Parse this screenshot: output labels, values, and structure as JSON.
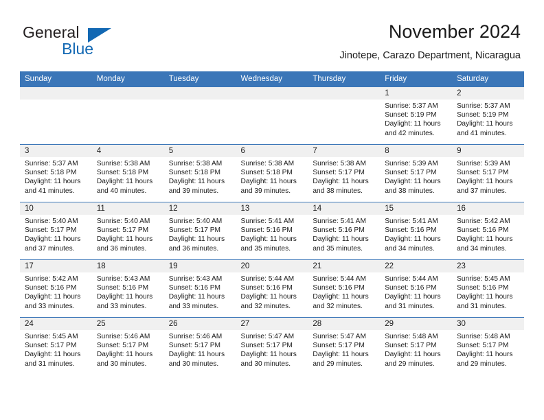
{
  "brand": {
    "name_part1": "General",
    "name_part2": "Blue",
    "accent_color": "#1268b3",
    "triangle_icon": "triangle-icon"
  },
  "header": {
    "title": "November 2024",
    "subtitle": "Jinotepe, Carazo Department, Nicaragua"
  },
  "calendar": {
    "header_bg": "#3b76b8",
    "daynum_band_bg": "#f0f0f0",
    "weekdays": [
      "Sunday",
      "Monday",
      "Tuesday",
      "Wednesday",
      "Thursday",
      "Friday",
      "Saturday"
    ],
    "labels": {
      "sunrise": "Sunrise:",
      "sunset": "Sunset:",
      "daylight": "Daylight:"
    },
    "weeks": [
      [
        {
          "day": "",
          "empty": true
        },
        {
          "day": "",
          "empty": true
        },
        {
          "day": "",
          "empty": true
        },
        {
          "day": "",
          "empty": true
        },
        {
          "day": "",
          "empty": true
        },
        {
          "day": "1",
          "sunrise": "Sunrise: 5:37 AM",
          "sunset": "Sunset: 5:19 PM",
          "daylight1": "Daylight: 11 hours",
          "daylight2": "and 42 minutes."
        },
        {
          "day": "2",
          "sunrise": "Sunrise: 5:37 AM",
          "sunset": "Sunset: 5:19 PM",
          "daylight1": "Daylight: 11 hours",
          "daylight2": "and 41 minutes."
        }
      ],
      [
        {
          "day": "3",
          "sunrise": "Sunrise: 5:37 AM",
          "sunset": "Sunset: 5:18 PM",
          "daylight1": "Daylight: 11 hours",
          "daylight2": "and 41 minutes."
        },
        {
          "day": "4",
          "sunrise": "Sunrise: 5:38 AM",
          "sunset": "Sunset: 5:18 PM",
          "daylight1": "Daylight: 11 hours",
          "daylight2": "and 40 minutes."
        },
        {
          "day": "5",
          "sunrise": "Sunrise: 5:38 AM",
          "sunset": "Sunset: 5:18 PM",
          "daylight1": "Daylight: 11 hours",
          "daylight2": "and 39 minutes."
        },
        {
          "day": "6",
          "sunrise": "Sunrise: 5:38 AM",
          "sunset": "Sunset: 5:18 PM",
          "daylight1": "Daylight: 11 hours",
          "daylight2": "and 39 minutes."
        },
        {
          "day": "7",
          "sunrise": "Sunrise: 5:38 AM",
          "sunset": "Sunset: 5:17 PM",
          "daylight1": "Daylight: 11 hours",
          "daylight2": "and 38 minutes."
        },
        {
          "day": "8",
          "sunrise": "Sunrise: 5:39 AM",
          "sunset": "Sunset: 5:17 PM",
          "daylight1": "Daylight: 11 hours",
          "daylight2": "and 38 minutes."
        },
        {
          "day": "9",
          "sunrise": "Sunrise: 5:39 AM",
          "sunset": "Sunset: 5:17 PM",
          "daylight1": "Daylight: 11 hours",
          "daylight2": "and 37 minutes."
        }
      ],
      [
        {
          "day": "10",
          "sunrise": "Sunrise: 5:40 AM",
          "sunset": "Sunset: 5:17 PM",
          "daylight1": "Daylight: 11 hours",
          "daylight2": "and 37 minutes."
        },
        {
          "day": "11",
          "sunrise": "Sunrise: 5:40 AM",
          "sunset": "Sunset: 5:17 PM",
          "daylight1": "Daylight: 11 hours",
          "daylight2": "and 36 minutes."
        },
        {
          "day": "12",
          "sunrise": "Sunrise: 5:40 AM",
          "sunset": "Sunset: 5:17 PM",
          "daylight1": "Daylight: 11 hours",
          "daylight2": "and 36 minutes."
        },
        {
          "day": "13",
          "sunrise": "Sunrise: 5:41 AM",
          "sunset": "Sunset: 5:16 PM",
          "daylight1": "Daylight: 11 hours",
          "daylight2": "and 35 minutes."
        },
        {
          "day": "14",
          "sunrise": "Sunrise: 5:41 AM",
          "sunset": "Sunset: 5:16 PM",
          "daylight1": "Daylight: 11 hours",
          "daylight2": "and 35 minutes."
        },
        {
          "day": "15",
          "sunrise": "Sunrise: 5:41 AM",
          "sunset": "Sunset: 5:16 PM",
          "daylight1": "Daylight: 11 hours",
          "daylight2": "and 34 minutes."
        },
        {
          "day": "16",
          "sunrise": "Sunrise: 5:42 AM",
          "sunset": "Sunset: 5:16 PM",
          "daylight1": "Daylight: 11 hours",
          "daylight2": "and 34 minutes."
        }
      ],
      [
        {
          "day": "17",
          "sunrise": "Sunrise: 5:42 AM",
          "sunset": "Sunset: 5:16 PM",
          "daylight1": "Daylight: 11 hours",
          "daylight2": "and 33 minutes."
        },
        {
          "day": "18",
          "sunrise": "Sunrise: 5:43 AM",
          "sunset": "Sunset: 5:16 PM",
          "daylight1": "Daylight: 11 hours",
          "daylight2": "and 33 minutes."
        },
        {
          "day": "19",
          "sunrise": "Sunrise: 5:43 AM",
          "sunset": "Sunset: 5:16 PM",
          "daylight1": "Daylight: 11 hours",
          "daylight2": "and 33 minutes."
        },
        {
          "day": "20",
          "sunrise": "Sunrise: 5:44 AM",
          "sunset": "Sunset: 5:16 PM",
          "daylight1": "Daylight: 11 hours",
          "daylight2": "and 32 minutes."
        },
        {
          "day": "21",
          "sunrise": "Sunrise: 5:44 AM",
          "sunset": "Sunset: 5:16 PM",
          "daylight1": "Daylight: 11 hours",
          "daylight2": "and 32 minutes."
        },
        {
          "day": "22",
          "sunrise": "Sunrise: 5:44 AM",
          "sunset": "Sunset: 5:16 PM",
          "daylight1": "Daylight: 11 hours",
          "daylight2": "and 31 minutes."
        },
        {
          "day": "23",
          "sunrise": "Sunrise: 5:45 AM",
          "sunset": "Sunset: 5:16 PM",
          "daylight1": "Daylight: 11 hours",
          "daylight2": "and 31 minutes."
        }
      ],
      [
        {
          "day": "24",
          "sunrise": "Sunrise: 5:45 AM",
          "sunset": "Sunset: 5:17 PM",
          "daylight1": "Daylight: 11 hours",
          "daylight2": "and 31 minutes."
        },
        {
          "day": "25",
          "sunrise": "Sunrise: 5:46 AM",
          "sunset": "Sunset: 5:17 PM",
          "daylight1": "Daylight: 11 hours",
          "daylight2": "and 30 minutes."
        },
        {
          "day": "26",
          "sunrise": "Sunrise: 5:46 AM",
          "sunset": "Sunset: 5:17 PM",
          "daylight1": "Daylight: 11 hours",
          "daylight2": "and 30 minutes."
        },
        {
          "day": "27",
          "sunrise": "Sunrise: 5:47 AM",
          "sunset": "Sunset: 5:17 PM",
          "daylight1": "Daylight: 11 hours",
          "daylight2": "and 30 minutes."
        },
        {
          "day": "28",
          "sunrise": "Sunrise: 5:47 AM",
          "sunset": "Sunset: 5:17 PM",
          "daylight1": "Daylight: 11 hours",
          "daylight2": "and 29 minutes."
        },
        {
          "day": "29",
          "sunrise": "Sunrise: 5:48 AM",
          "sunset": "Sunset: 5:17 PM",
          "daylight1": "Daylight: 11 hours",
          "daylight2": "and 29 minutes."
        },
        {
          "day": "30",
          "sunrise": "Sunrise: 5:48 AM",
          "sunset": "Sunset: 5:17 PM",
          "daylight1": "Daylight: 11 hours",
          "daylight2": "and 29 minutes."
        }
      ]
    ]
  }
}
